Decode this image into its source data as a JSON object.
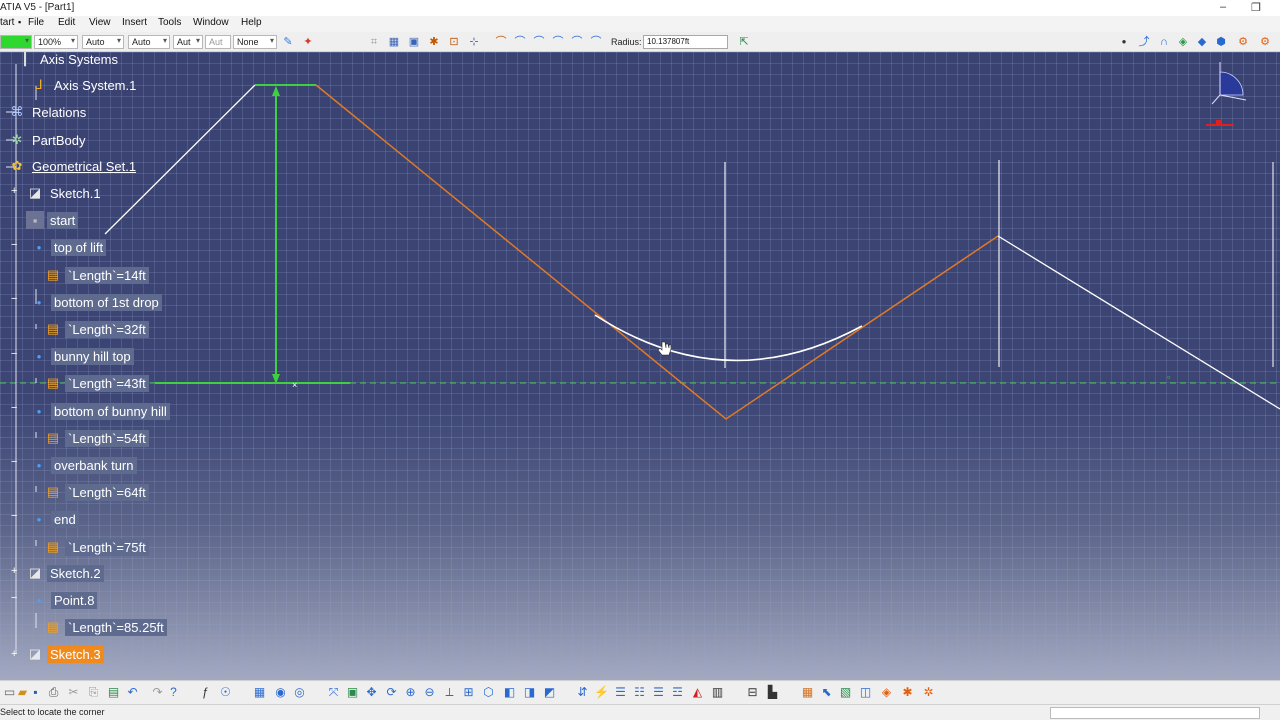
{
  "window": {
    "title": "ATIA V5 - [Part1]",
    "minimize": "–",
    "restore": "❐"
  },
  "menu": [
    "tart",
    "File",
    "Edit",
    "View",
    "Insert",
    "Tools",
    "Window",
    "Help"
  ],
  "toolbar": {
    "zoom": "100%",
    "combo1": "Auto",
    "combo2": "Auto",
    "combo3": "Aut",
    "combo4": "Aut",
    "combo5": "None",
    "radius_label": "Radius:",
    "radius_value": "10.137807ft"
  },
  "tree": {
    "axis_systems": "Axis Systems",
    "axis_system_1": "Axis System.1",
    "relations": "Relations",
    "partbody": "PartBody",
    "geometrical_set": "Geometrical Set.1",
    "sketch1": "Sketch.1",
    "start": "start",
    "top_of_lift": "top of lift",
    "length_14": "`Length`=14ft",
    "bottom_first_drop": "bottom of 1st drop",
    "length_32": "`Length`=32ft",
    "bunny_hill_top": "bunny hill top",
    "length_43": "`Length`=43ft",
    "bottom_bunny_hill": "bottom of bunny hill",
    "length_54": "`Length`=54ft",
    "overbank_turn": "overbank turn",
    "length_64": "`Length`=64ft",
    "end": "end",
    "length_75": "`Length`=75ft",
    "sketch2": "Sketch.2",
    "point8": "Point.8",
    "length_85": "`Length`=85.25ft",
    "sketch3": "Sketch.3"
  },
  "status": {
    "text": "Select to locate the corner"
  },
  "colors": {
    "viewport": "#3d4775",
    "orange_line": "#e07a26",
    "green_line": "#39d33c",
    "selection": "#f08a1c"
  }
}
